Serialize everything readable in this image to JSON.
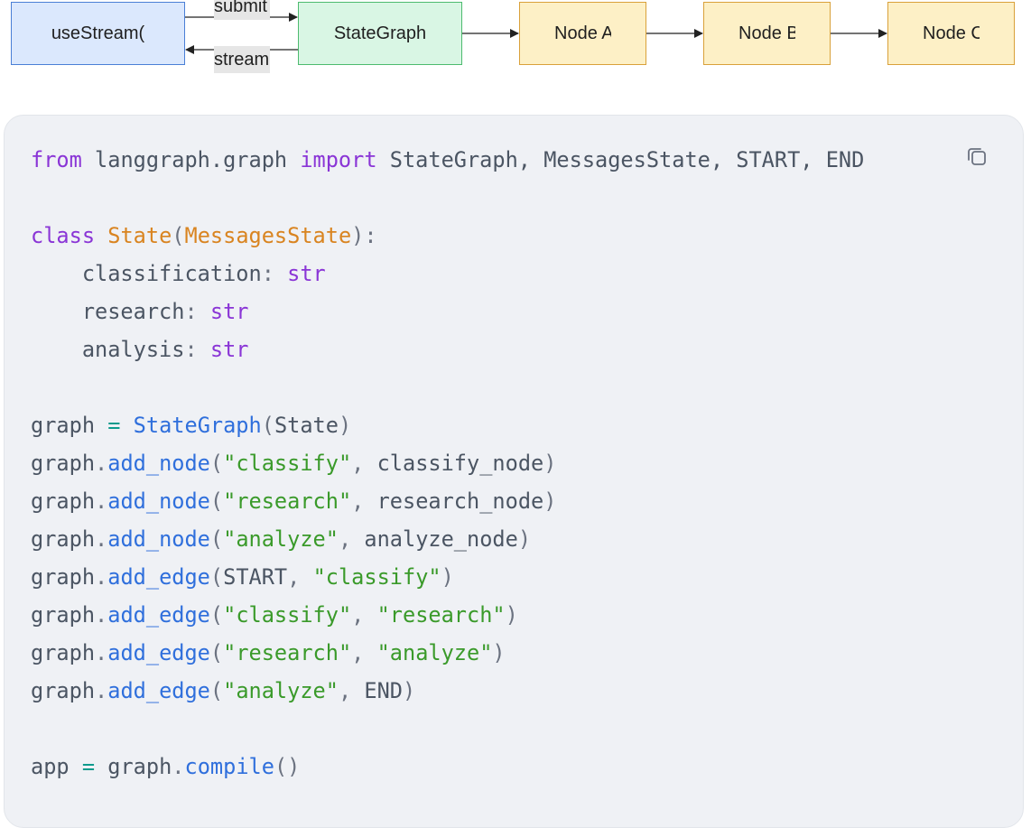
{
  "diagram": {
    "client_label": "useStream(",
    "graph_label": "StateGraph",
    "node_a_label": "Node A",
    "node_b_label": "Node B",
    "node_c_label": "Node C",
    "submit_label": "submit",
    "stream_label": "stream"
  },
  "code": {
    "lines": [
      [
        [
          "kw",
          "from"
        ],
        [
          "id",
          " langgraph.graph "
        ],
        [
          "kw",
          "import"
        ],
        [
          "id",
          " StateGraph, MessagesState, START, END"
        ]
      ],
      [],
      [
        [
          "kw",
          "class"
        ],
        [
          "id",
          " "
        ],
        [
          "cls",
          "State"
        ],
        [
          "pn",
          "("
        ],
        [
          "cls",
          "MessagesState"
        ],
        [
          "pn",
          "):"
        ]
      ],
      [
        [
          "id",
          "    classification"
        ],
        [
          "pn",
          ": "
        ],
        [
          "kw",
          "str"
        ]
      ],
      [
        [
          "id",
          "    research"
        ],
        [
          "pn",
          ": "
        ],
        [
          "kw",
          "str"
        ]
      ],
      [
        [
          "id",
          "    analysis"
        ],
        [
          "pn",
          ": "
        ],
        [
          "kw",
          "str"
        ]
      ],
      [],
      [
        [
          "id",
          "graph "
        ],
        [
          "op",
          "="
        ],
        [
          "id",
          " "
        ],
        [
          "fn",
          "StateGraph"
        ],
        [
          "pn",
          "("
        ],
        [
          "id",
          "State"
        ],
        [
          "pn",
          ")"
        ]
      ],
      [
        [
          "id",
          "graph"
        ],
        [
          "pn",
          "."
        ],
        [
          "fn",
          "add_node"
        ],
        [
          "pn",
          "("
        ],
        [
          "str",
          "\"classify\""
        ],
        [
          "pn",
          ", "
        ],
        [
          "id",
          "classify_node"
        ],
        [
          "pn",
          ")"
        ]
      ],
      [
        [
          "id",
          "graph"
        ],
        [
          "pn",
          "."
        ],
        [
          "fn",
          "add_node"
        ],
        [
          "pn",
          "("
        ],
        [
          "str",
          "\"research\""
        ],
        [
          "pn",
          ", "
        ],
        [
          "id",
          "research_node"
        ],
        [
          "pn",
          ")"
        ]
      ],
      [
        [
          "id",
          "graph"
        ],
        [
          "pn",
          "."
        ],
        [
          "fn",
          "add_node"
        ],
        [
          "pn",
          "("
        ],
        [
          "str",
          "\"analyze\""
        ],
        [
          "pn",
          ", "
        ],
        [
          "id",
          "analyze_node"
        ],
        [
          "pn",
          ")"
        ]
      ],
      [
        [
          "id",
          "graph"
        ],
        [
          "pn",
          "."
        ],
        [
          "fn",
          "add_edge"
        ],
        [
          "pn",
          "("
        ],
        [
          "id",
          "START"
        ],
        [
          "pn",
          ", "
        ],
        [
          "str",
          "\"classify\""
        ],
        [
          "pn",
          ")"
        ]
      ],
      [
        [
          "id",
          "graph"
        ],
        [
          "pn",
          "."
        ],
        [
          "fn",
          "add_edge"
        ],
        [
          "pn",
          "("
        ],
        [
          "str",
          "\"classify\""
        ],
        [
          "pn",
          ", "
        ],
        [
          "str",
          "\"research\""
        ],
        [
          "pn",
          ")"
        ]
      ],
      [
        [
          "id",
          "graph"
        ],
        [
          "pn",
          "."
        ],
        [
          "fn",
          "add_edge"
        ],
        [
          "pn",
          "("
        ],
        [
          "str",
          "\"research\""
        ],
        [
          "pn",
          ", "
        ],
        [
          "str",
          "\"analyze\""
        ],
        [
          "pn",
          ")"
        ]
      ],
      [
        [
          "id",
          "graph"
        ],
        [
          "pn",
          "."
        ],
        [
          "fn",
          "add_edge"
        ],
        [
          "pn",
          "("
        ],
        [
          "str",
          "\"analyze\""
        ],
        [
          "pn",
          ", "
        ],
        [
          "id",
          "END"
        ],
        [
          "pn",
          ")"
        ]
      ],
      [],
      [
        [
          "id",
          "app "
        ],
        [
          "op",
          "="
        ],
        [
          "id",
          " graph"
        ],
        [
          "pn",
          "."
        ],
        [
          "fn",
          "compile"
        ],
        [
          "pn",
          "()"
        ]
      ]
    ]
  },
  "icons": {
    "copy": "copy-icon"
  },
  "colors": {
    "keyword": "#8a35d6",
    "class_name": "#d98420",
    "function": "#2f6fdc",
    "string": "#3a9a2a",
    "operator": "#0e9a8c",
    "code_background": "#eff1f5"
  }
}
